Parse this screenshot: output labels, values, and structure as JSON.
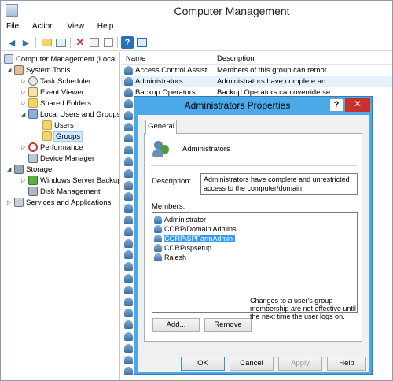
{
  "window": {
    "title": "Computer Management"
  },
  "menu": {
    "items": [
      "File",
      "Action",
      "View",
      "Help"
    ]
  },
  "toolbar": {
    "back_icon": "arrow-left-icon",
    "forward_icon": "arrow-right-icon",
    "up_icon": "folder-up-icon",
    "delete_icon": "delete-x-icon",
    "help_icon": "help-icon"
  },
  "tree": {
    "root": "Computer Management (Local",
    "system_tools": "System Tools",
    "task_scheduler": "Task Scheduler",
    "event_viewer": "Event Viewer",
    "shared_folders": "Shared Folders",
    "local_users_groups": "Local Users and Groups",
    "users": "Users",
    "groups": "Groups",
    "performance": "Performance",
    "device_manager": "Device Manager",
    "storage": "Storage",
    "windows_server_backup": "Windows Server Backup",
    "disk_management": "Disk Management",
    "services_apps": "Services and Applications"
  },
  "list": {
    "columns": {
      "name": "Name",
      "description": "Description"
    },
    "rows": [
      {
        "name": "Access Control Assist...",
        "description": "Members of this group can remot..."
      },
      {
        "name": "Administrators",
        "description": "Administrators have complete an..."
      },
      {
        "name": "Backup Operators",
        "description": "Backup Operators can override se..."
      }
    ]
  },
  "dialog": {
    "title": "Administrators Properties",
    "help_label": "?",
    "close_label": "✕",
    "tab_general": "General",
    "group_name": "Administrators",
    "description_label": "Description:",
    "description_value": "Administrators have complete and unrestricted access to the computer/domain",
    "members_label": "Members:",
    "members": [
      "Administrator",
      "CORP\\Domain Admins",
      "CORP\\SPFarmAdmin",
      "CORP\\spsetup",
      "Rajesh"
    ],
    "add_label": "Add...",
    "remove_label": "Remove",
    "note": "Changes to a user's group membership are not effective until the next time the user logs on.",
    "ok_label": "OK",
    "cancel_label": "Cancel",
    "apply_label": "Apply",
    "help_button_label": "Help"
  }
}
